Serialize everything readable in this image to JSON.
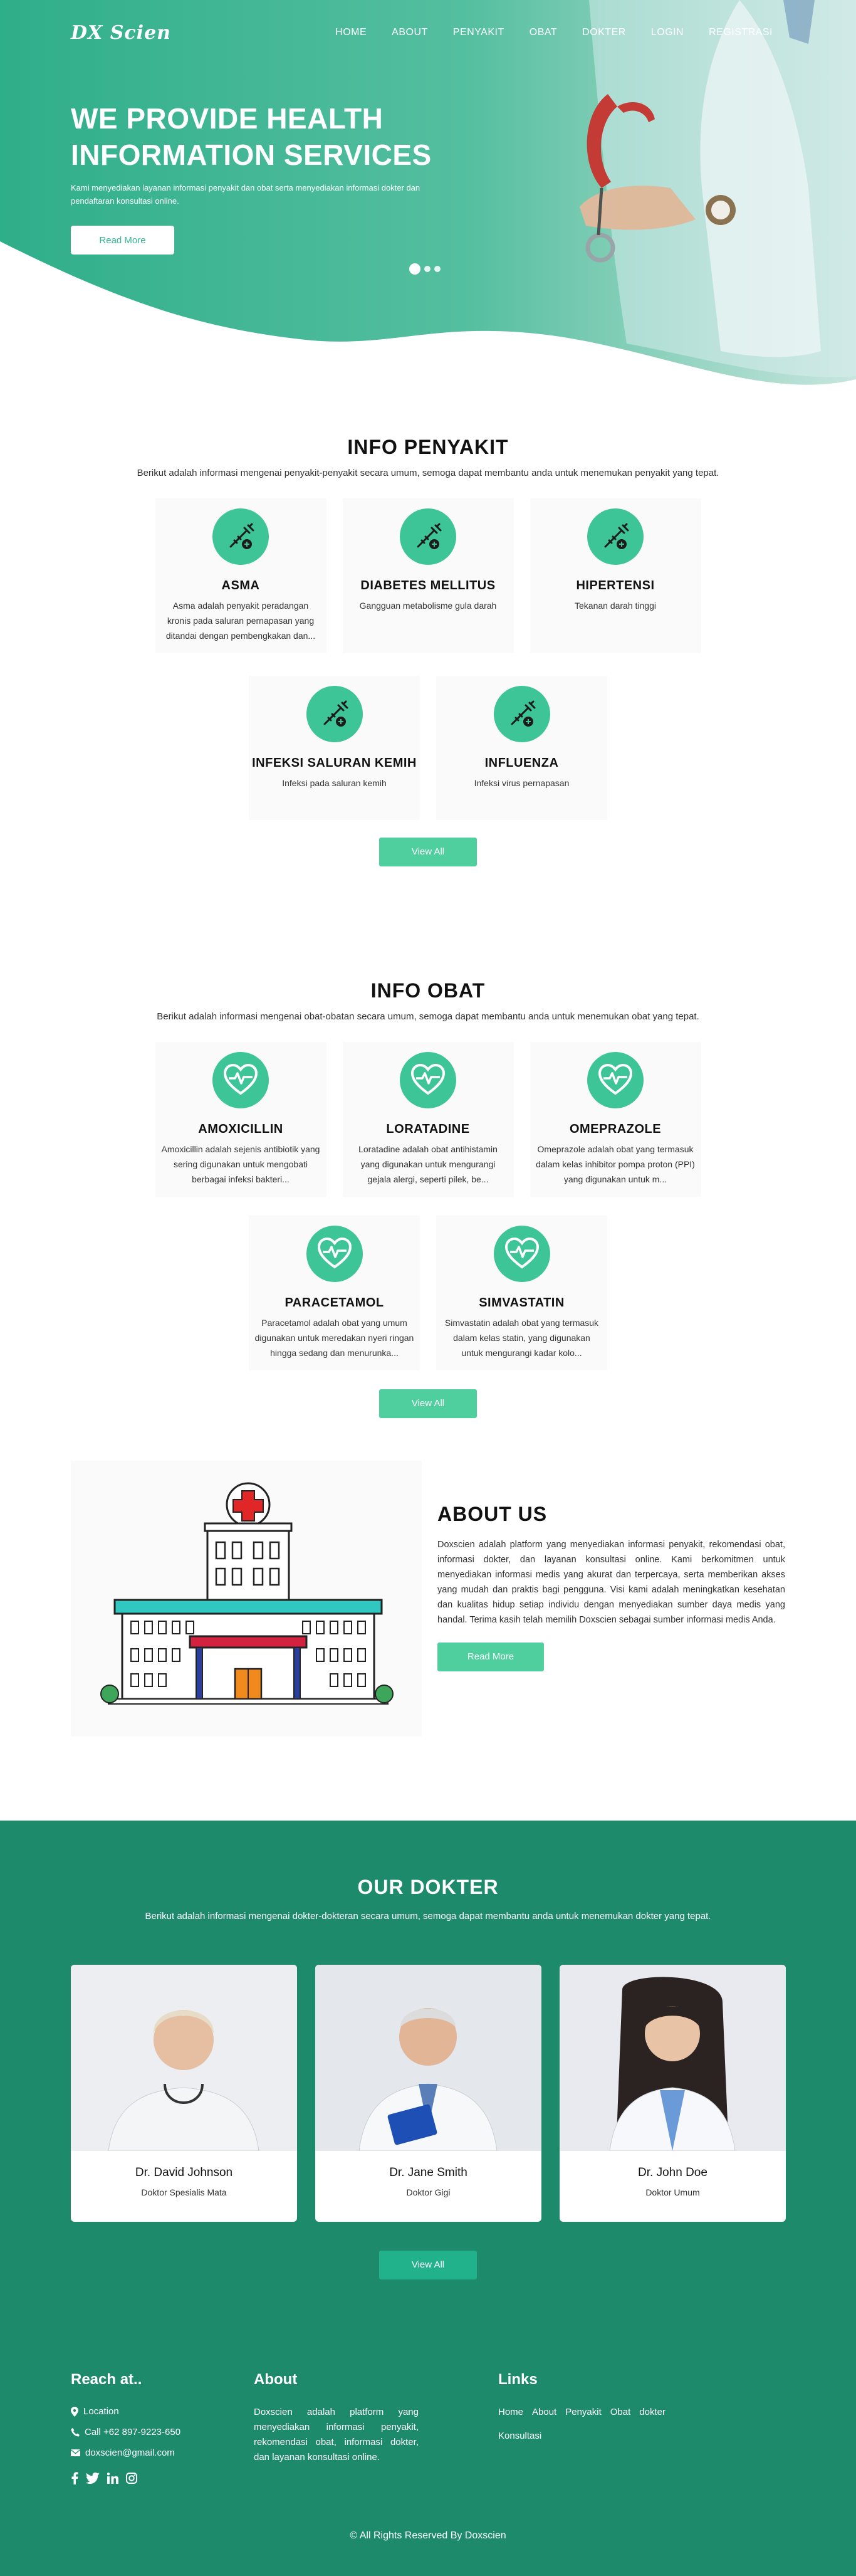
{
  "brand": {
    "logo": "DX Scien"
  },
  "nav": {
    "items": [
      "HOME",
      "ABOUT",
      "PENYAKIT",
      "OBAT",
      "DOKTER",
      "LOGIN",
      "REGISTRASI"
    ]
  },
  "hero": {
    "title_line1": "WE PROVIDE HEALTH",
    "title_line2": "INFORMATION SERVICES",
    "subtitle": "Kami menyediakan layanan informasi penyakit dan obat serta menyediakan informasi dokter dan pendaftaran konsultasi online.",
    "button": "Read More"
  },
  "penyakit": {
    "title": "INFO PENYAKIT",
    "subtitle": "Berikut adalah informasi mengenai penyakit-penyakit secara umum, semoga dapat membantu anda untuk menemukan penyakit yang tepat.",
    "items": [
      {
        "name": "ASMA",
        "desc": "Asma adalah penyakit peradangan kronis pada saluran pernapasan yang ditandai dengan pembengkakan dan..."
      },
      {
        "name": "DIABETES MELLITUS",
        "desc": "Gangguan metabolisme gula darah"
      },
      {
        "name": "HIPERTENSI",
        "desc": "Tekanan darah tinggi"
      },
      {
        "name": "INFEKSI SALURAN KEMIH",
        "desc": "Infeksi pada saluran kemih"
      },
      {
        "name": "INFLUENZA",
        "desc": "Infeksi virus pernapasan"
      }
    ],
    "button": "View All"
  },
  "obat": {
    "title": "INFO OBAT",
    "subtitle": "Berikut adalah informasi mengenai obat-obatan secara umum, semoga dapat membantu anda untuk menemukan obat yang tepat.",
    "items": [
      {
        "name": "AMOXICILLIN",
        "desc": "Amoxicillin adalah sejenis antibiotik yang sering digunakan untuk mengobati berbagai infeksi bakteri..."
      },
      {
        "name": "LORATADINE",
        "desc": "Loratadine adalah obat antihistamin yang digunakan untuk mengurangi gejala alergi, seperti pilek, be..."
      },
      {
        "name": "OMEPRAZOLE",
        "desc": "Omeprazole adalah obat yang termasuk dalam kelas inhibitor pompa proton (PPI) yang digunakan untuk m..."
      },
      {
        "name": "PARACETAMOL",
        "desc": "Paracetamol adalah obat yang umum digunakan untuk meredakan nyeri ringan hingga sedang dan menurunka..."
      },
      {
        "name": "SIMVASTATIN",
        "desc": "Simvastatin adalah obat yang termasuk dalam kelas statin, yang digunakan untuk mengurangi kadar kolo..."
      }
    ],
    "button": "View All"
  },
  "about": {
    "title": "ABOUT US",
    "text": "Doxscien adalah platform yang menyediakan informasi penyakit, rekomendasi obat, informasi dokter, dan layanan konsultasi online. Kami berkomitmen untuk menyediakan informasi medis yang akurat dan terpercaya, serta memberikan akses yang mudah dan praktis bagi pengguna. Visi kami adalah meningkatkan kesehatan dan kualitas hidup setiap individu dengan menyediakan sumber daya medis yang handal. Terima kasih telah memilih Doxscien sebagai sumber informasi medis Anda.",
    "button": "Read More"
  },
  "dokter": {
    "title": "OUR DOKTER",
    "subtitle": "Berikut adalah informasi mengenai dokter-dokteran secara umum, semoga dapat membantu anda untuk menemukan dokter yang tepat.",
    "items": [
      {
        "name": "Dr. David Johnson",
        "role": "Doktor Spesialis Mata"
      },
      {
        "name": "Dr. Jane Smith",
        "role": "Doktor Gigi"
      },
      {
        "name": "Dr. John Doe",
        "role": "Doktor Umum"
      }
    ],
    "button": "View All"
  },
  "footer": {
    "reach_title": "Reach at..",
    "location": "Location",
    "phone": "Call +62 897-9223-650",
    "email": "doxscien@gmail.com",
    "about_title": "About",
    "about_text": "Doxscien adalah platform yang menyediakan informasi penyakit, rekomendasi obat, informasi dokter, dan layanan konsultasi online.",
    "links_title": "Links",
    "links": [
      "Home",
      "About",
      "Penyakit",
      "Obat",
      "dokter",
      "Konsultasi"
    ],
    "copyright": "© All Rights Reserved By Doxscien"
  },
  "colors": {
    "primary": "#3ec597",
    "hero": "#35b38f",
    "footer": "#1e8a6c",
    "button": "#4fcf9e"
  }
}
